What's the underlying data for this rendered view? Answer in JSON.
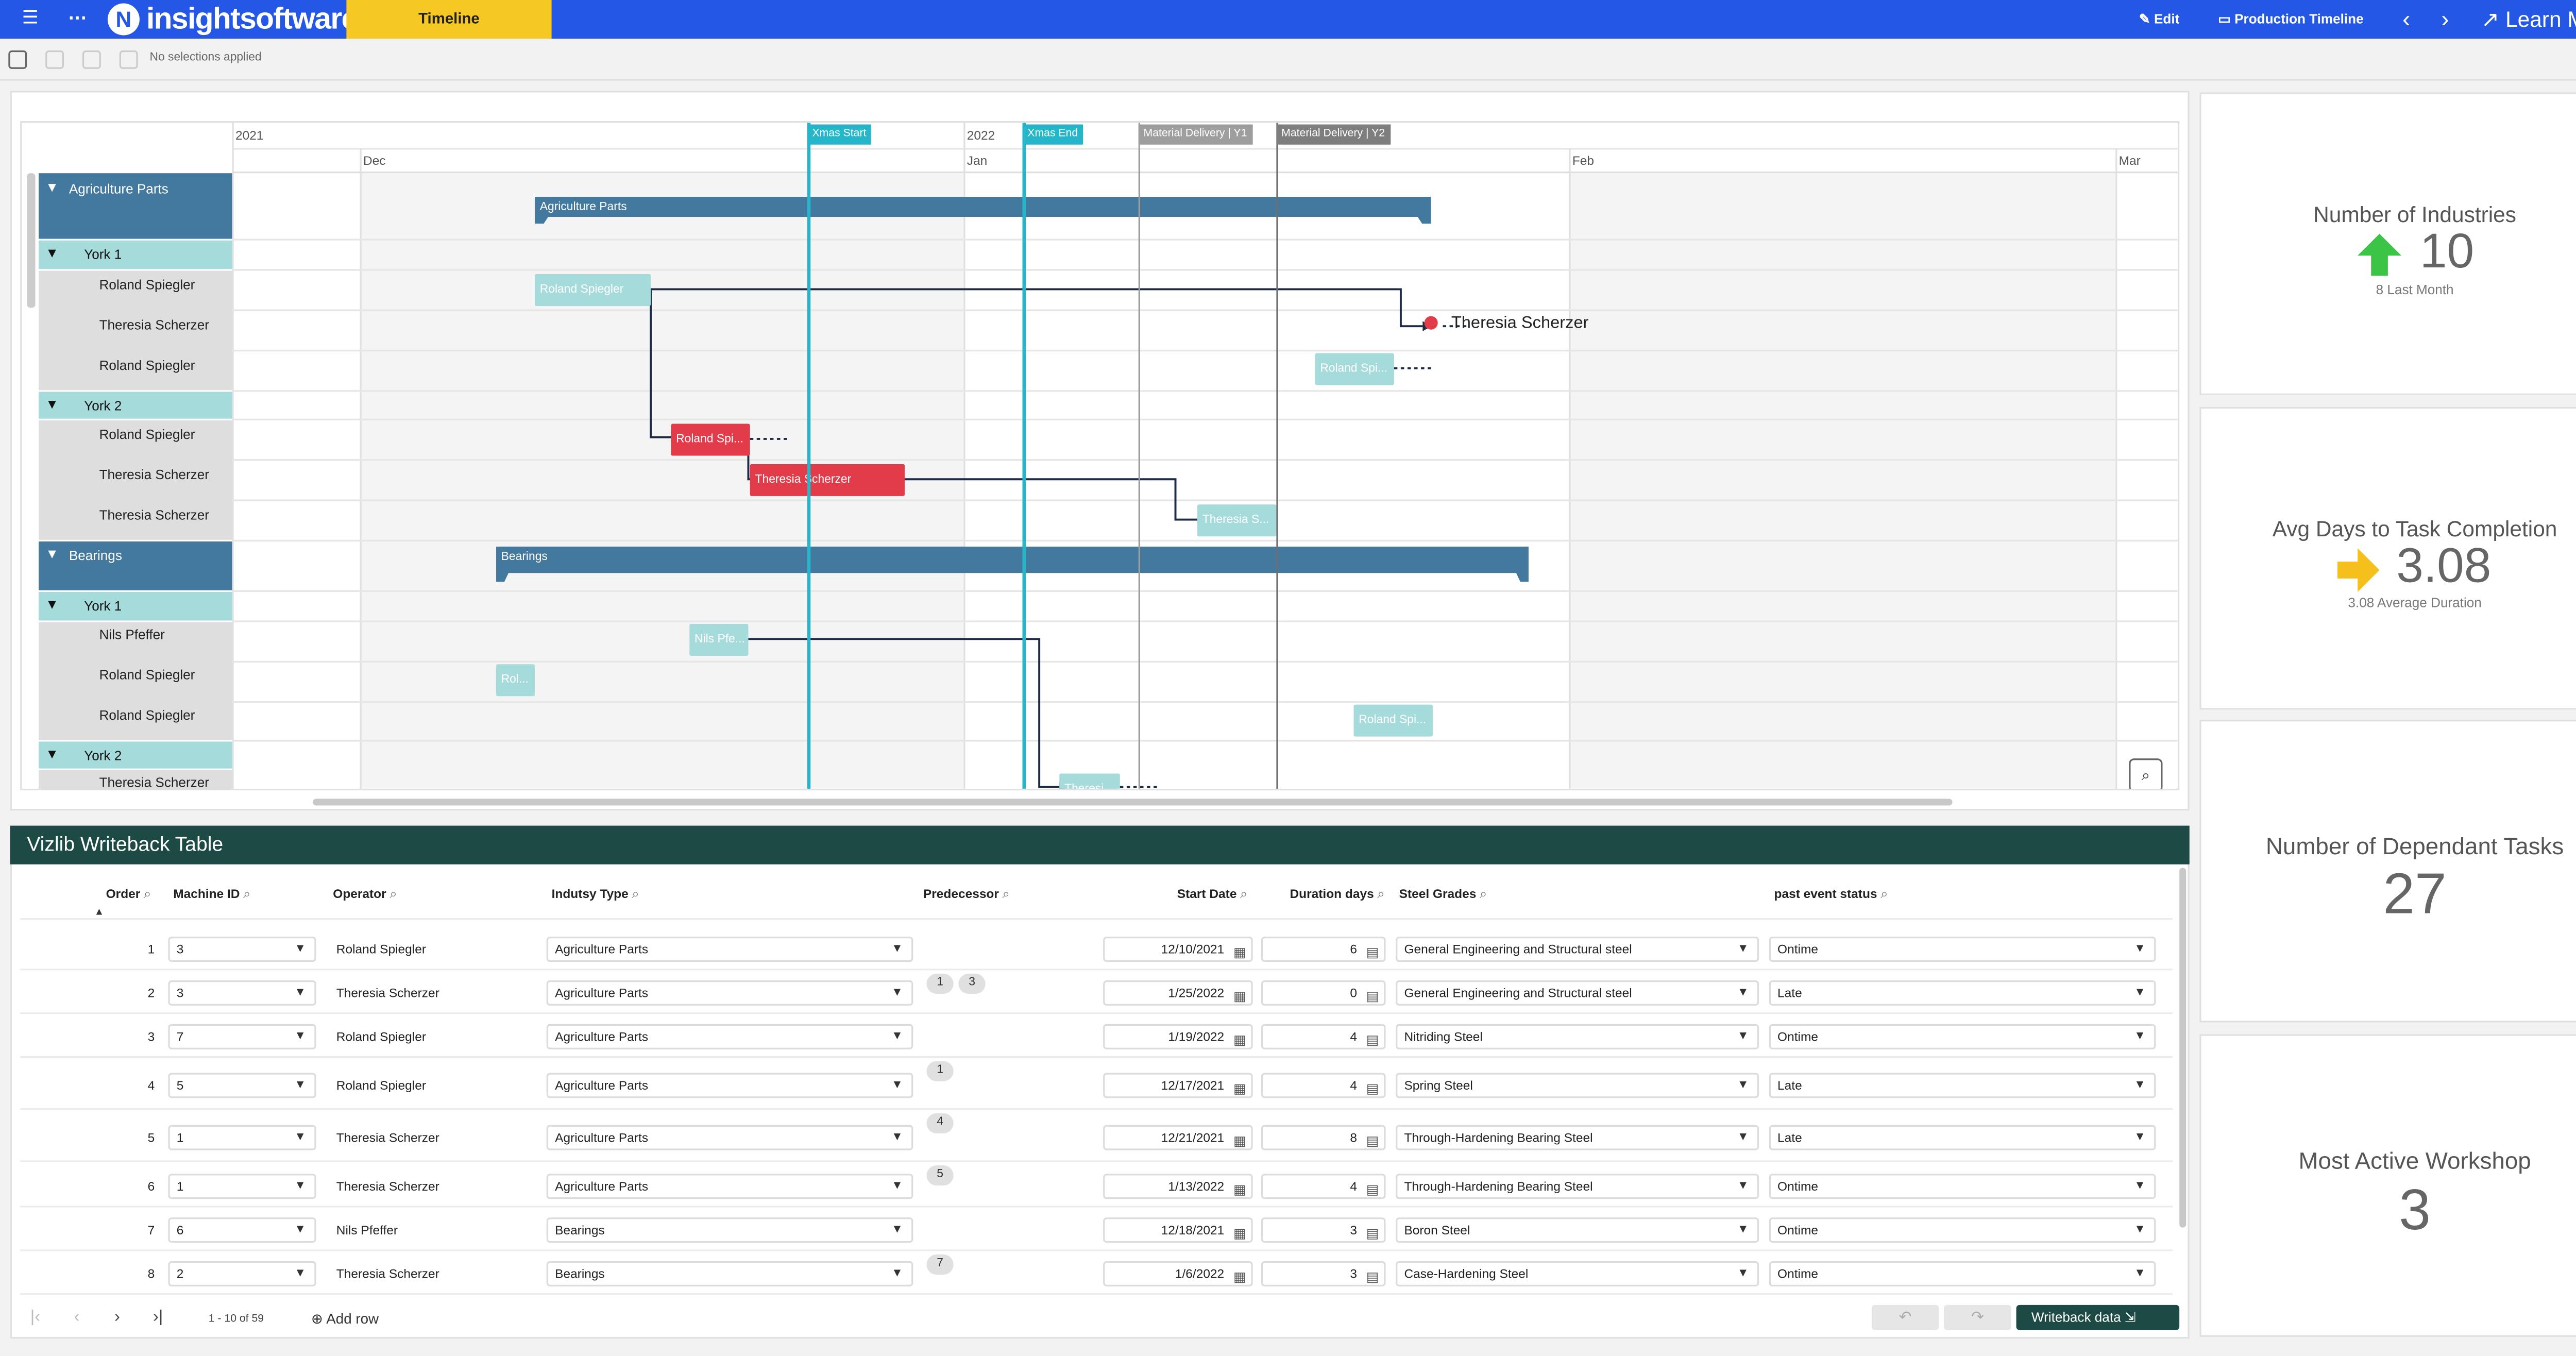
{
  "topbar": {
    "menu_icon": "☰",
    "more_icon": "⋯",
    "logo_text": "insightsoftware",
    "active_tab": "Timeline",
    "edit_label": "Edit",
    "sheet_name": "Production Timeline",
    "prev_icon": "‹",
    "next_icon": "›",
    "learn_more": "Learn More!",
    "accent": "#2457e6",
    "tab_color": "#f6c824"
  },
  "selections": {
    "text": "No selections applied"
  },
  "gantt": {
    "years": [
      "2021",
      "2022"
    ],
    "months": [
      "Dec",
      "Jan",
      "Feb",
      "Mar"
    ],
    "markers": [
      "Xmas Start",
      "Xmas End",
      "Material Delivery | Y1",
      "Material Delivery | Y2"
    ],
    "groups": [
      {
        "name": "Agriculture Parts",
        "summary": "Agriculture Parts"
      },
      {
        "name": "Bearings",
        "summary": "Bearings"
      }
    ],
    "subgroups": [
      "York 1",
      "York 2",
      "York 1",
      "York 2"
    ],
    "rows": [
      "Roland Spiegler",
      "Theresia Scherzer",
      "Roland Spiegler",
      "Roland Spiegler",
      "Theresia Scherzer",
      "Theresia Scherzer",
      "Nils Pfeffer",
      "Roland Spiegler",
      "Roland Spiegler",
      "Theresia Scherzer"
    ],
    "bars": [
      "Roland Spiegler",
      "Roland Spi...",
      "Roland Spi...",
      "Theresia Scherzer",
      "Theresia S...",
      "Nils Pfe...",
      "Rol...",
      "Roland Spi...",
      "Theresi..."
    ],
    "floating_label": "Theresia Scherzer",
    "colors": {
      "group": "#44799f",
      "subgroup": "#a6dbdc",
      "light_bar": "#a6dbdc",
      "red_bar": "#e23b4a",
      "marker_teal": "#26b5c9",
      "marker_gray": "#9e9e9e"
    }
  },
  "kpis": [
    {
      "title": "Number of Industries",
      "value": "10",
      "sub": "8 Last Month",
      "icon": "arrow-up-icon",
      "icon_color": "#3cc447"
    },
    {
      "title": "Avg Days to Task Completion",
      "value": "3.08",
      "sub": "3.08 Average Duration",
      "icon": "arrow-right-icon",
      "icon_color": "#f6c01c"
    },
    {
      "title": "Number of Dependant Tasks",
      "value": "27"
    },
    {
      "title": "Most Active Workshop",
      "value": "3"
    }
  ],
  "table": {
    "title": "Vizlib Writeback Table",
    "columns": [
      "Order",
      "Machine ID",
      "Operator",
      "Indutsy Type",
      "Predecessor",
      "Start Date",
      "Duration days",
      "Steel Grades",
      "past event status"
    ],
    "rows": [
      {
        "order": "1",
        "machine": "3",
        "operator": "Roland Spiegler",
        "type": "Agriculture Parts",
        "pred": [],
        "start": "12/10/2021",
        "dur": "6",
        "steel": "General Engineering and Structural steel",
        "status": "Ontime"
      },
      {
        "order": "2",
        "machine": "3",
        "operator": "Theresia Scherzer",
        "type": "Agriculture Parts",
        "pred": [
          "1",
          "3"
        ],
        "start": "1/25/2022",
        "dur": "0",
        "steel": "General Engineering and Structural steel",
        "status": "Late"
      },
      {
        "order": "3",
        "machine": "7",
        "operator": "Roland Spiegler",
        "type": "Agriculture Parts",
        "pred": [],
        "start": "1/19/2022",
        "dur": "4",
        "steel": "Nitriding Steel",
        "status": "Ontime"
      },
      {
        "order": "4",
        "machine": "5",
        "operator": "Roland Spiegler",
        "type": "Agriculture Parts",
        "pred": [
          "1"
        ],
        "start": "12/17/2021",
        "dur": "4",
        "steel": "Spring Steel",
        "status": "Late"
      },
      {
        "order": "5",
        "machine": "1",
        "operator": "Theresia Scherzer",
        "type": "Agriculture Parts",
        "pred": [
          "4"
        ],
        "start": "12/21/2021",
        "dur": "8",
        "steel": "Through-Hardening Bearing Steel",
        "status": "Late"
      },
      {
        "order": "6",
        "machine": "1",
        "operator": "Theresia Scherzer",
        "type": "Agriculture Parts",
        "pred": [
          "5"
        ],
        "start": "1/13/2022",
        "dur": "4",
        "steel": "Through-Hardening Bearing Steel",
        "status": "Ontime"
      },
      {
        "order": "7",
        "machine": "6",
        "operator": "Nils Pfeffer",
        "type": "Bearings",
        "pred": [],
        "start": "12/18/2021",
        "dur": "3",
        "steel": "Boron Steel",
        "status": "Ontime"
      },
      {
        "order": "8",
        "machine": "2",
        "operator": "Theresia Scherzer",
        "type": "Bearings",
        "pred": [
          "7"
        ],
        "start": "1/6/2022",
        "dur": "3",
        "steel": "Case-Hardening Steel",
        "status": "Ontime"
      }
    ],
    "pagination": "1 - 10 of 59",
    "add_row": "Add row",
    "writeback_label": "Writeback data",
    "header_color": "#1d4a44"
  }
}
